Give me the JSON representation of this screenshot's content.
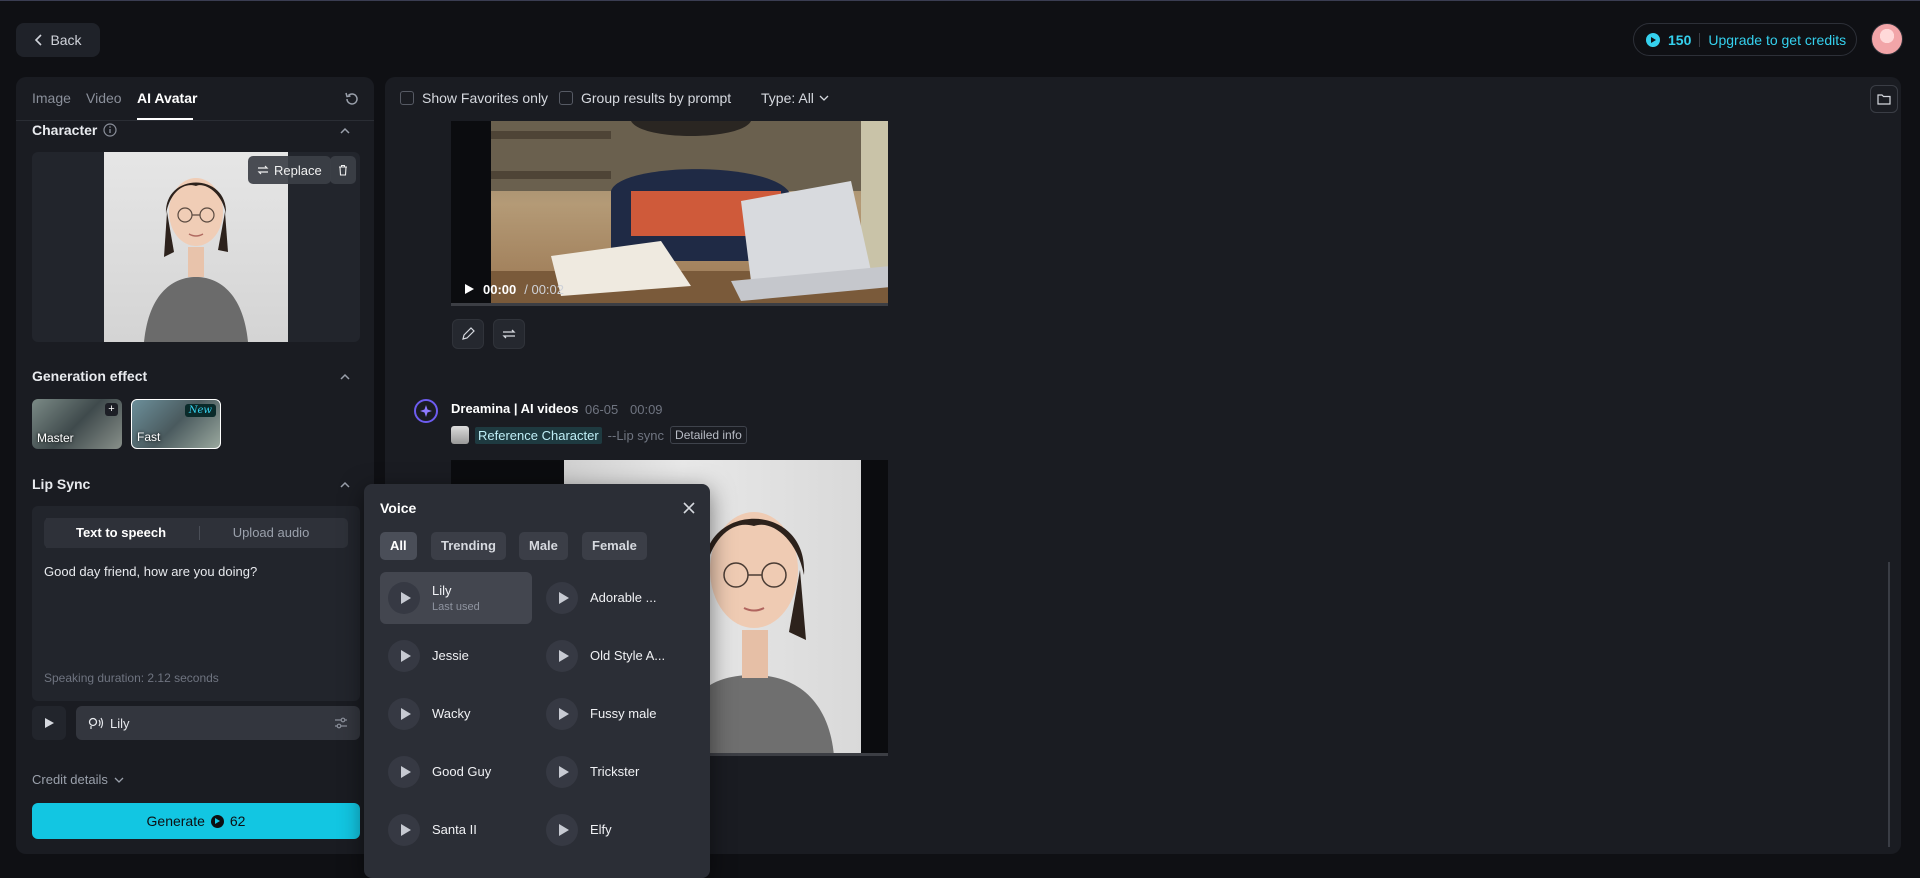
{
  "header": {
    "back_label": "Back",
    "credits": "150",
    "upgrade_label": "Upgrade to get credits"
  },
  "left_panel": {
    "tabs": [
      "Image",
      "Video",
      "AI Avatar"
    ],
    "active_tab": "AI Avatar",
    "character": {
      "title": "Character",
      "replace_label": "Replace"
    },
    "generation_effect": {
      "title": "Generation effect",
      "options": [
        {
          "label": "Master",
          "badge": "+"
        },
        {
          "label": "Fast",
          "badge": "New"
        }
      ]
    },
    "lip_sync": {
      "title": "Lip Sync",
      "modes": [
        "Text to speech",
        "Upload audio"
      ],
      "text": "Good day friend, how are you doing?",
      "duration": "Speaking duration: 2.12 seconds",
      "voice": "Lily"
    },
    "credit_details": "Credit details",
    "generate": {
      "label": "Generate",
      "cost": "62"
    }
  },
  "main": {
    "toolbar": {
      "show_favorites": "Show Favorites only",
      "group_results": "Group results by prompt",
      "type_filter": "Type: All"
    },
    "video1": {
      "time": "00:00",
      "duration": "/ 00:02"
    },
    "entry": {
      "title": "Dreamina | AI videos",
      "date": "06-05",
      "time": "00:09",
      "reference": "Reference Character",
      "mode": "--Lip sync",
      "detail_label": "Detailed info"
    }
  },
  "voice_popup": {
    "title": "Voice",
    "filters": [
      "All",
      "Trending",
      "Male",
      "Female"
    ],
    "active_filter": "All",
    "voices": [
      {
        "name": "Lily",
        "sub": "Last used"
      },
      {
        "name": "Adorable ..."
      },
      {
        "name": "Jessie"
      },
      {
        "name": "Old Style A..."
      },
      {
        "name": "Wacky"
      },
      {
        "name": "Fussy male"
      },
      {
        "name": "Good Guy"
      },
      {
        "name": "Trickster"
      },
      {
        "name": "Santa II"
      },
      {
        "name": "Elfy"
      }
    ]
  },
  "colors": {
    "accent": "#12c6e2",
    "background": "#0f1014",
    "panel": "#1a1c22"
  }
}
